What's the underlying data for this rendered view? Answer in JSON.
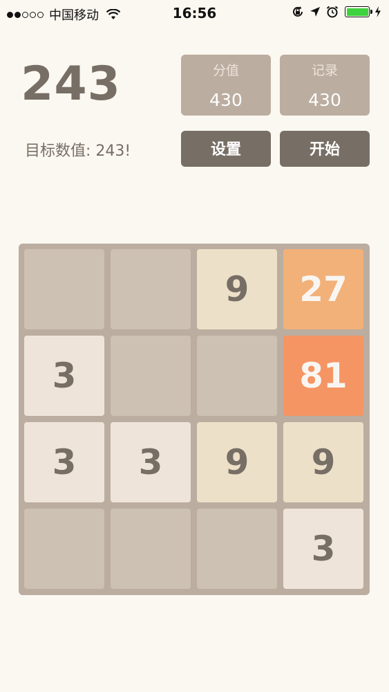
{
  "status_bar": {
    "carrier": "中国移动",
    "time": "16:56"
  },
  "game": {
    "title": "243",
    "target_label": "目标数值: 243!",
    "score": {
      "label": "分值",
      "value": "430"
    },
    "best": {
      "label": "记录",
      "value": "430"
    },
    "settings_label": "设置",
    "start_label": "开始"
  },
  "board": {
    "rows": [
      [
        "",
        "",
        "9",
        "27"
      ],
      [
        "3",
        "",
        "",
        "81"
      ],
      [
        "3",
        "3",
        "9",
        "9"
      ],
      [
        "",
        "",
        "",
        "3"
      ]
    ]
  },
  "colors": {
    "background": "#fbf8f1",
    "board": "#bbada0",
    "empty_cell": "#cdc1b4",
    "tile_3": "#eee4da",
    "tile_9": "#ede0c8",
    "tile_27": "#f2b179",
    "tile_81": "#f59563",
    "text": "#776e65",
    "button": "#776e65",
    "battery": "#3fd23f"
  },
  "icons": {
    "status": [
      "signal-dots-icon",
      "wifi-icon",
      "orientation-lock-icon",
      "location-arrow-icon",
      "alarm-clock-icon",
      "battery-icon",
      "charging-bolt-icon"
    ]
  }
}
